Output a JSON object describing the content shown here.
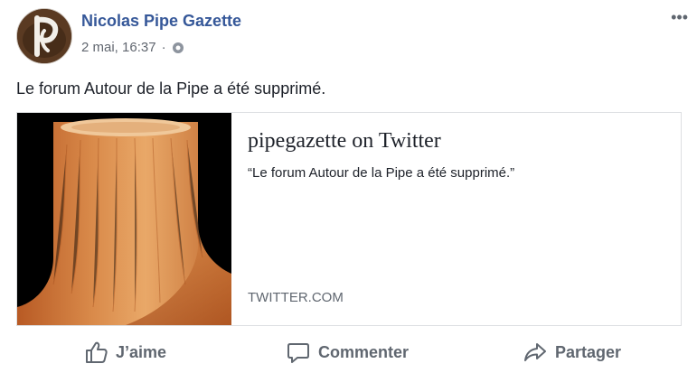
{
  "post": {
    "author": "Nicolas Pipe Gazette",
    "timestamp": "2 mai, 16:37",
    "separator": "·",
    "privacy_icon": "globe-icon",
    "more_label": "•••",
    "text": "Le forum Autour de la Pipe a été supprimé."
  },
  "link_card": {
    "title": "pipegazette on Twitter",
    "description": "“Le forum Autour de la Pipe a été supprimé.”",
    "domain": "TWITTER.COM"
  },
  "actions": {
    "like_label": "J’aime",
    "comment_label": "Commenter",
    "share_label": "Partager"
  },
  "colors": {
    "author": "#365899",
    "meta": "#616770",
    "action": "#606770",
    "border": "#dddfe2"
  }
}
